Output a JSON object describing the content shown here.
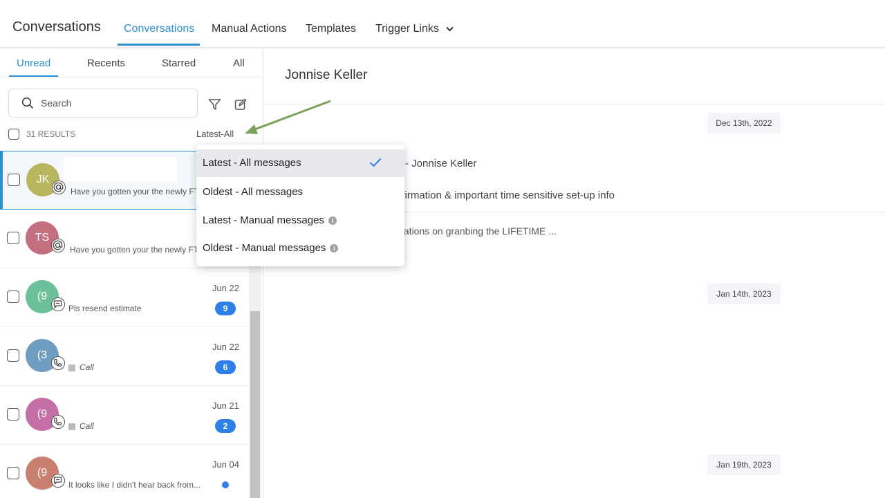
{
  "topnav": {
    "title": "Conversations",
    "tabs": [
      {
        "label": "Conversations",
        "active": true
      },
      {
        "label": "Manual Actions"
      },
      {
        "label": "Templates"
      },
      {
        "label": "Trigger Links"
      }
    ]
  },
  "left": {
    "tabs": [
      {
        "label": "Unread",
        "active": true
      },
      {
        "label": "Recents"
      },
      {
        "label": "Starred"
      },
      {
        "label": "All"
      }
    ],
    "search_placeholder": "Search",
    "results": "31 RESULTS",
    "sort_label": "Latest-All",
    "conversations": [
      {
        "initials": "JK",
        "avatar_color": "#b8b55f",
        "channel_icon": "at-icon",
        "preview": "Have you gotten your the newly FTC",
        "selected": true
      },
      {
        "initials": "TS",
        "avatar_color": "#c46f7f",
        "channel_icon": "at-icon",
        "preview": "Have you gotten your the newly FTC"
      },
      {
        "initials": "(9",
        "avatar_color": "#6cc19a",
        "channel_icon": "sms-icon",
        "preview": "Pls resend estimate",
        "date": "Jun 22",
        "count": "9"
      },
      {
        "initials": "(3",
        "avatar_color": "#6f9ec0",
        "channel_icon": "phone-icon",
        "preview": "Call",
        "date": "Jun 22",
        "count": "6"
      },
      {
        "initials": "(9",
        "avatar_color": "#c46fa6",
        "channel_icon": "phone-icon",
        "preview": "Call",
        "date": "Jun 21",
        "count": "2"
      },
      {
        "initials": "(9",
        "avatar_color": "#c98070",
        "channel_icon": "sms-icon",
        "preview": "It looks like I didn't hear back from...",
        "date": "Jun 04"
      }
    ]
  },
  "right": {
    "contact_name": "Jonnise Keller",
    "date_chips": [
      "Dec 13th, 2022",
      "Jan 14th, 2023",
      "Jan 19th, 2023"
    ],
    "messages": [
      "- Jonnise Keller",
      "nfirmation & important time sensitive set-up info",
      "ulations on granbing the LIFETIME ..."
    ]
  },
  "dropdown": {
    "items": [
      {
        "label": "Latest - All messages",
        "selected": true
      },
      {
        "label": "Oldest - All messages"
      },
      {
        "label": "Latest - Manual messages",
        "info": true
      },
      {
        "label": "Oldest - Manual messages",
        "info": true
      }
    ]
  },
  "colors": {
    "accent": "#2e8fd1",
    "badge": "#2e7fe8",
    "annotation_arrow": "#7aa35a"
  }
}
